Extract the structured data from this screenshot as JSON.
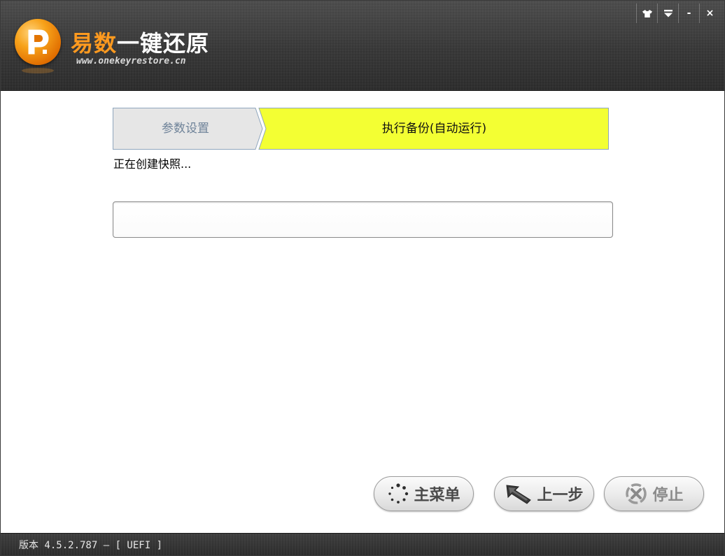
{
  "window": {
    "title_orange": "易数",
    "title_white": "一键还原",
    "url": "www.onekeyrestore.cn",
    "controls": {
      "skin_icon": "tshirt-icon",
      "menu_icon": "dropdown-icon",
      "minimize_label": "-",
      "close_label": "×"
    }
  },
  "steps": [
    {
      "label": "参数设置",
      "state": "done"
    },
    {
      "label": "执行备份(自动运行)",
      "state": "active"
    }
  ],
  "status": {
    "message": "正在创建快照..."
  },
  "progress": {
    "value": 0
  },
  "buttons": {
    "main_menu": "主菜单",
    "previous": "上一步",
    "stop": "停止"
  },
  "footer": {
    "version": "版本 4.5.2.787 — [ UEFI ]"
  },
  "colors": {
    "active_step": "#f3ff33",
    "done_step": "#e6e6e6",
    "brand_orange": "#ff9a1f",
    "titlebar": "#353535"
  }
}
